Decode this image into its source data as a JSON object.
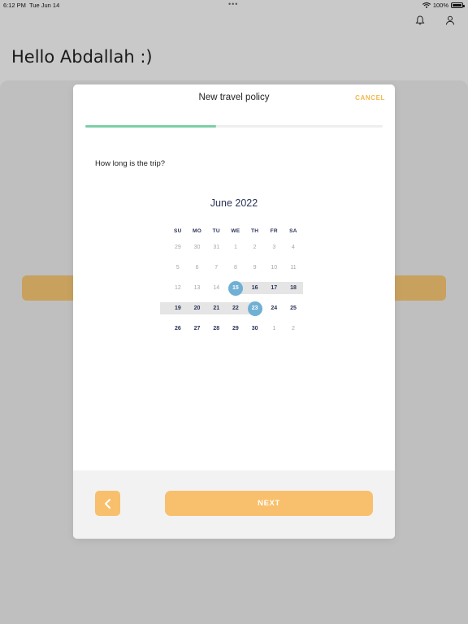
{
  "status_bar": {
    "time": "6:12 PM",
    "date": "Tue Jun 14",
    "dots": "•••",
    "battery": "100%"
  },
  "header": {
    "greeting": "Hello Abdallah :)",
    "icons": [
      "bell-icon",
      "user-icon"
    ]
  },
  "modal": {
    "title": "New travel policy",
    "cancel_label": "CANCEL",
    "progress": 0.44,
    "question": "How long is the trip?",
    "calendar": {
      "month_label": "June 2022",
      "weekdays": [
        "SU",
        "MO",
        "TU",
        "WE",
        "TH",
        "FR",
        "SA"
      ],
      "weeks": [
        [
          {
            "d": "29",
            "m": true
          },
          {
            "d": "30",
            "m": true
          },
          {
            "d": "31",
            "m": true
          },
          {
            "d": "1",
            "m": true
          },
          {
            "d": "2",
            "m": true
          },
          {
            "d": "3",
            "m": true
          },
          {
            "d": "4",
            "m": true
          }
        ],
        [
          {
            "d": "5",
            "m": true
          },
          {
            "d": "6",
            "m": true
          },
          {
            "d": "7",
            "m": true
          },
          {
            "d": "8",
            "m": true
          },
          {
            "d": "9",
            "m": true
          },
          {
            "d": "10",
            "m": true
          },
          {
            "d": "11",
            "m": true
          }
        ],
        [
          {
            "d": "12",
            "m": true
          },
          {
            "d": "13",
            "m": true
          },
          {
            "d": "14",
            "m": true
          },
          {
            "d": "15",
            "s": true
          },
          {
            "d": "16"
          },
          {
            "d": "17"
          },
          {
            "d": "18"
          }
        ],
        [
          {
            "d": "19"
          },
          {
            "d": "20"
          },
          {
            "d": "21"
          },
          {
            "d": "22"
          },
          {
            "d": "23",
            "s": true
          },
          {
            "d": "24"
          },
          {
            "d": "25"
          }
        ],
        [
          {
            "d": "26"
          },
          {
            "d": "27"
          },
          {
            "d": "28"
          },
          {
            "d": "29"
          },
          {
            "d": "30"
          },
          {
            "d": "1",
            "m": true
          },
          {
            "d": "2",
            "m": true
          }
        ]
      ],
      "range_start": "15",
      "range_end": "23"
    },
    "footer": {
      "back_icon": "chevron-left-icon",
      "next_label": "NEXT"
    }
  },
  "colors": {
    "accent": "#f8c06d",
    "cancel": "#f2b84f",
    "progress": "#7ccfa6",
    "selected_day": "#6fb0d4",
    "range_band": "#e5e5e5"
  }
}
